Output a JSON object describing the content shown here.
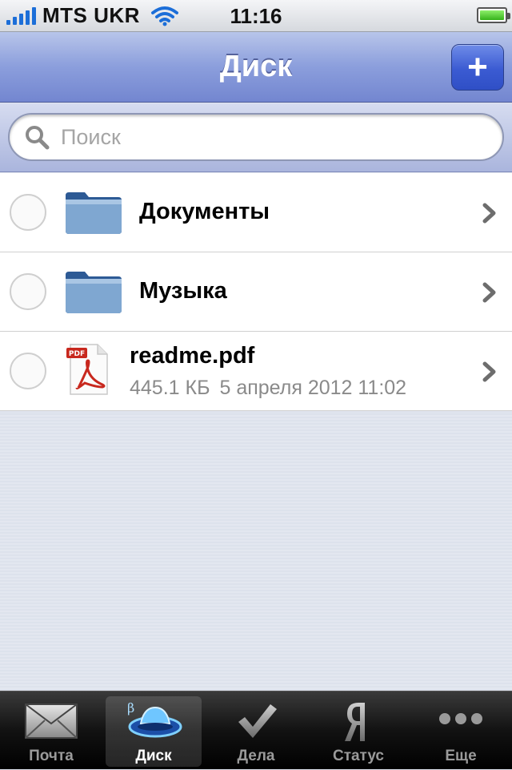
{
  "status_bar": {
    "carrier": "MTS UKR",
    "time": "11:16",
    "signal_bars": 5,
    "battery_level": 1.0
  },
  "nav": {
    "title": "Диск",
    "add_label": "+"
  },
  "search": {
    "placeholder": "Поиск",
    "value": ""
  },
  "items": [
    {
      "type": "folder",
      "name": "Документы"
    },
    {
      "type": "folder",
      "name": "Музыка"
    },
    {
      "type": "file",
      "icon": "pdf-file-icon",
      "name": "readme.pdf",
      "size": "445.1 КБ",
      "date": "5 апреля 2012 11:02"
    }
  ],
  "tabs": [
    {
      "label": "Почта",
      "icon": "mail-icon",
      "active": false
    },
    {
      "label": "Диск",
      "icon": "ufo-disk-icon",
      "active": true,
      "badge": "β"
    },
    {
      "label": "Дела",
      "icon": "checkmark-icon",
      "active": false
    },
    {
      "label": "Статус",
      "icon": "yandex-ya-icon",
      "active": false
    },
    {
      "label": "Еще",
      "icon": "more-dots-icon",
      "active": false
    }
  ],
  "colors": {
    "nav_accent": "#8b9edc",
    "add_button": "#3b5bd2",
    "battery": "#35b21a",
    "signal": "#1c6ed8"
  }
}
